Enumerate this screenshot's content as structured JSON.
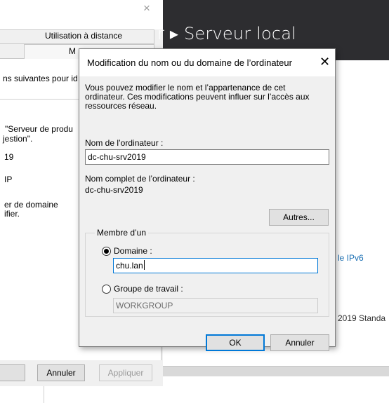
{
  "background_window": {
    "close_glyph": "×",
    "tabs": {
      "remote": "Utilisation à distance",
      "partial": "M"
    },
    "lines": [
      "ns suivantes pour id",
      "\"Serveur de produ",
      "jestion\".",
      "19",
      "IP",
      "er de domaine",
      "ifier."
    ],
    "buttons": {
      "cancel": "Annuler",
      "apply": "Appliquer"
    }
  },
  "server_manager": {
    "title": "r ▸ Serveur local",
    "ipv6_text": "le IPv6",
    "edition_text": "2019 Standa"
  },
  "dialog": {
    "title": "Modification du nom ou du domaine de l’ordinateur",
    "close_glyph": "✕",
    "description": "Vous pouvez modifier le nom et l’appartenance de cet ordinateur. Ces modifications peuvent influer sur l’accès aux ressources réseau.",
    "computer_name_label": "Nom de l’ordinateur :",
    "computer_name_value": "dc-chu-srv2019",
    "full_name_label": "Nom complet de l’ordinateur :",
    "full_name_value": "dc-chu-srv2019",
    "more_button": "Autres...",
    "member_of": {
      "legend": "Membre d’un",
      "domain_label": "Domaine :",
      "domain_value": "chu.lan",
      "domain_selected": true,
      "workgroup_label": "Groupe de travail :",
      "workgroup_value": "WORKGROUP",
      "workgroup_selected": false
    },
    "ok_button": "OK",
    "cancel_button": "Annuler"
  }
}
